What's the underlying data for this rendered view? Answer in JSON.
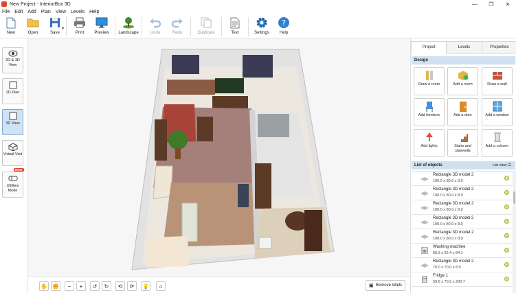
{
  "window": {
    "title": "New Project - InteriorBox 3D",
    "controls": [
      "—",
      "❐",
      "✕"
    ]
  },
  "menu": [
    "File",
    "Edit",
    "Add",
    "Plan",
    "View",
    "Levels",
    "Help"
  ],
  "toolbar": {
    "new": "New",
    "open": "Open",
    "save": "Save",
    "print": "Print",
    "preview": "Preview",
    "landscape": "Landscape",
    "undo": "Undo",
    "redo": "Redo",
    "duplicate": "Duplicate",
    "text": "Text",
    "settings": "Settings",
    "help": "Help"
  },
  "leftbar": {
    "view2d3d": "2D & 3D View",
    "plan2d": "2D Plan",
    "view3d": "3D View",
    "virtual": "Virtual Visit",
    "utilities": "Utilities Mode",
    "new_badge": "NEW"
  },
  "bottombar": {
    "remove_walls": "Remove Walls"
  },
  "panel": {
    "tabs": [
      "Project",
      "Levels",
      "Properties"
    ],
    "design_header": "Design",
    "design_buttons": [
      "Draw a room",
      "Add a room",
      "Draw a wall",
      "Add furniture",
      "Add a door",
      "Add a window",
      "Add lights",
      "Stairs and stairwells",
      "Add a column"
    ],
    "objects_header": "List of objects",
    "list_view": "List view",
    "objects": [
      {
        "name": "Rectangle 3D model 2",
        "dims": "100.0 x 80.0 x 8.0"
      },
      {
        "name": "Rectangle 3D model 2",
        "dims": "100.0 x 80.0 x 8.0"
      },
      {
        "name": "Rectangle 3D model 2",
        "dims": "100.0 x 80.0 x 8.0"
      },
      {
        "name": "Rectangle 3D model 2",
        "dims": "100.0 x 80.0 x 8.0"
      },
      {
        "name": "Rectangle 3D model 2",
        "dims": "100.0 x 80.0 x 8.0"
      },
      {
        "name": "Washing machine",
        "dims": "60.3 x 52.4 x 84.1"
      },
      {
        "name": "Rectangle 3D model 2",
        "dims": "70.0 x 70.0 x 8.0"
      },
      {
        "name": "Fridge 1",
        "dims": "59.6 x 70.9 x 200.7"
      }
    ]
  },
  "colors": {
    "accent": "#2f6fb5",
    "panel_header": "#cfe0f0",
    "active_button": "#cfe3f5"
  }
}
